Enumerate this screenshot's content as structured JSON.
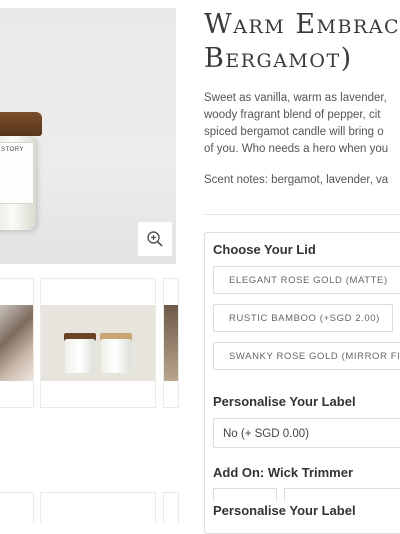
{
  "product": {
    "title_line1": "Warm Embrac",
    "title_line2": "Bergamot)",
    "description_lines": [
      "Sweet as vanilla, warm as lavender,",
      "woody fragrant blend of pepper, cit",
      "spiced bergamot candle will bring o",
      "of you. Who needs a hero when you"
    ],
    "scent_notes": "Scent notes: bergamot, lavender, va",
    "jar_label_text": "STORY"
  },
  "options": {
    "lid_label": "Choose Your Lid",
    "lid_options": [
      "ELEGANT ROSE GOLD (MATTE)",
      "RUSTIC BAMBOO (+SGD 2.00)",
      "SWANKY ROSE GOLD (MIRROR FIN"
    ],
    "personalise_label": "Personalise Your Label",
    "personalise_value": "No (+ SGD 0.00)",
    "addon_label": "Add On: Wick Trimmer",
    "personalise_label_2": "Personalise Your Label"
  },
  "icons": {
    "zoom": "zoom-in-icon"
  },
  "colors": {
    "lid_wood": "#6b4423",
    "lid_bamboo": "#c9a574",
    "border": "#dcdcdc"
  }
}
